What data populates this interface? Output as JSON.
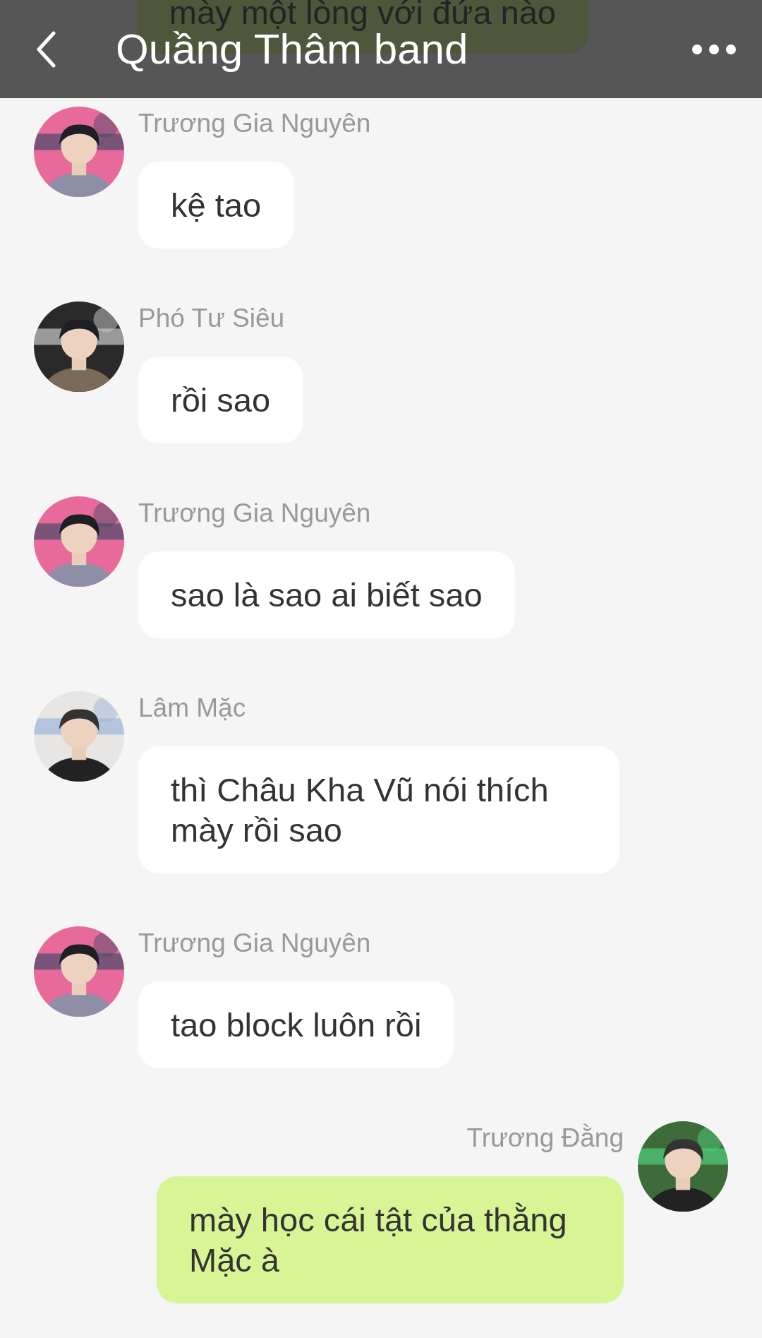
{
  "header": {
    "title": "Quầng Thâm band"
  },
  "cut_message": {
    "text": "mày một lòng với đứa nào",
    "kind": "self"
  },
  "messages": [
    {
      "sender": "Trương Gia Nguyên",
      "text": "kệ tao",
      "kind": "other"
    },
    {
      "sender": "Phó Tư Siêu",
      "text": "rồi sao",
      "kind": "other"
    },
    {
      "sender": "Trương Gia Nguyên",
      "text": "sao là sao ai biết sao",
      "kind": "other"
    },
    {
      "sender": "Lâm Mặc",
      "text": "thì Châu Kha Vũ nói thích mày rồi sao",
      "kind": "other"
    },
    {
      "sender": "Trương Gia Nguyên",
      "text": "tao block luôn rồi",
      "kind": "other"
    },
    {
      "sender": "Trương Đằng",
      "text": "mày học cái tật của thằng Mặc à",
      "kind": "self"
    }
  ]
}
